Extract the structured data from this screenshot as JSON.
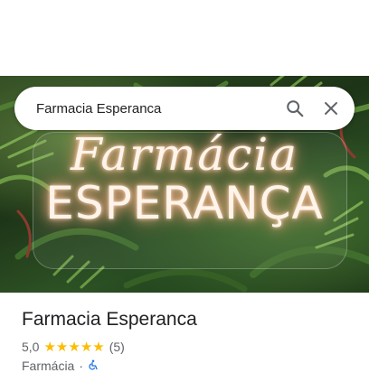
{
  "search": {
    "query": "Farmacia Esperanca",
    "search_icon": "search-icon",
    "close_icon": "close-icon"
  },
  "hero": {
    "sign_line1": "Farmácia",
    "sign_line2": "ESPERANÇA"
  },
  "place": {
    "name": "Farmacia Esperanca",
    "rating_text": "5,0",
    "rating": 5.0,
    "stars_max": 5,
    "review_count": "(5)",
    "category": "Farmácia",
    "separator": "·",
    "accessibility_icon": "wheelchair-icon"
  },
  "colors": {
    "star": "#fbbc04",
    "text_primary": "#202124",
    "text_secondary": "#5f6368",
    "accessibility_icon": "#1a73e8"
  }
}
